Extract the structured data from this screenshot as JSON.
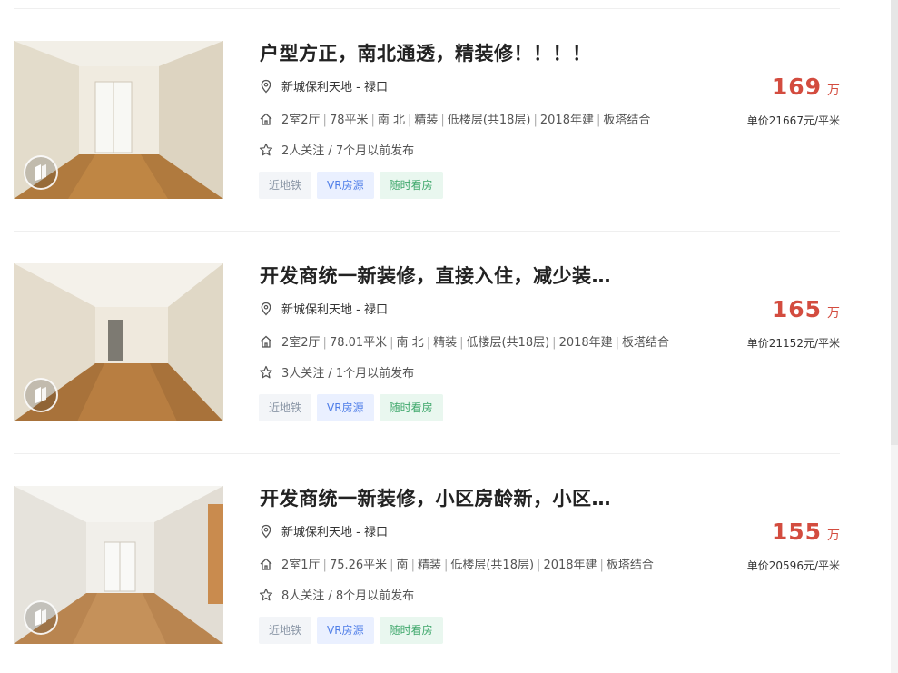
{
  "listings": [
    {
      "title": "户型方正，南北通透，精装修！！！！",
      "location": "新城保利天地 - 禄口",
      "info": [
        "2室2厅",
        "78平米",
        "南 北",
        "精装",
        "低楼层(共18层)",
        "2018年建",
        "板塔结合"
      ],
      "follow": "2人关注 / 7个月以前发布",
      "price": "169",
      "price_unit": "万",
      "unit_price": "单价21667元/平米",
      "tags": [
        "近地铁",
        "VR房源",
        "随时看房"
      ]
    },
    {
      "title": "开发商统一新装修，直接入住，减少装…",
      "location": "新城保利天地 - 禄口",
      "info": [
        "2室2厅",
        "78.01平米",
        "南 北",
        "精装",
        "低楼层(共18层)",
        "2018年建",
        "板塔结合"
      ],
      "follow": "3人关注 / 1个月以前发布",
      "price": "165",
      "price_unit": "万",
      "unit_price": "单价21152元/平米",
      "tags": [
        "近地铁",
        "VR房源",
        "随时看房"
      ]
    },
    {
      "title": "开发商统一新装修，小区房龄新，小区…",
      "location": "新城保利天地 - 禄口",
      "info": [
        "2室1厅",
        "75.26平米",
        "南",
        "精装",
        "低楼层(共18层)",
        "2018年建",
        "板塔结合"
      ],
      "follow": "8人关注 / 8个月以前发布",
      "price": "155",
      "price_unit": "万",
      "unit_price": "单价20596元/平米",
      "tags": [
        "近地铁",
        "VR房源",
        "随时看房"
      ]
    }
  ],
  "icons": {
    "location": "location-pin-icon",
    "house": "house-icon",
    "star": "star-icon",
    "vr": "vr-logo-icon"
  },
  "colors": {
    "price": "#d34c3f",
    "tag_vr": "#4f7ee8",
    "tag_visit": "#3fa86c",
    "tag_subway": "#8a96a6"
  }
}
